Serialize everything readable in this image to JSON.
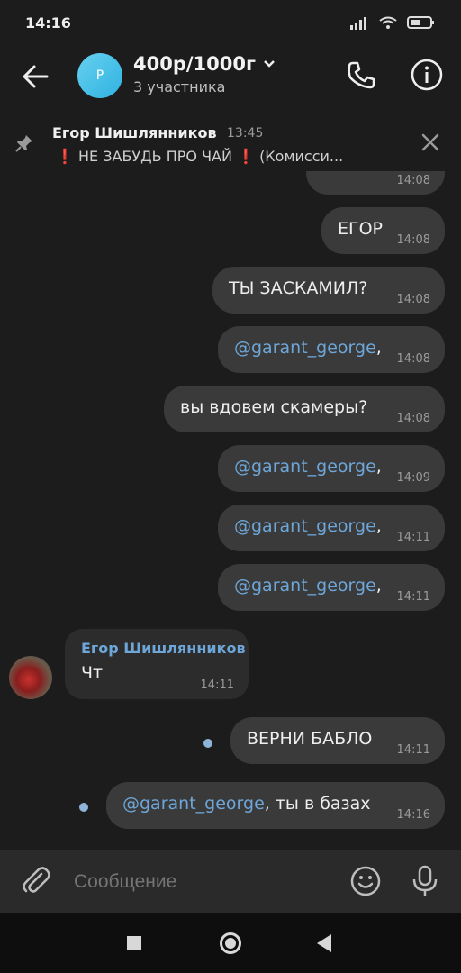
{
  "status": {
    "time": "14:16"
  },
  "header": {
    "avatar_letter": "P",
    "title": "400р/1000г",
    "subtitle": "3 участника"
  },
  "pinned": {
    "author": "Егор Шишлянников",
    "time": "13:45",
    "text": "❗ НЕ ЗАБУДЬ ПРО ЧАЙ ❗  (Комисси..."
  },
  "messages": [
    {
      "text": "",
      "time": "14:08"
    },
    {
      "text": "ЕГОР",
      "time": "14:08"
    },
    {
      "text": "ТЫ ЗАСКАМИЛ?",
      "time": "14:08"
    },
    {
      "mention": "@garant_george",
      "suffix": ",",
      "time": "14:08"
    },
    {
      "text": "вы вдовем скамеры?",
      "time": "14:08"
    },
    {
      "mention": "@garant_george",
      "suffix": ",",
      "time": "14:09"
    },
    {
      "mention": "@garant_george",
      "suffix": ",",
      "time": "14:11"
    },
    {
      "mention": "@garant_george",
      "suffix": ",",
      "time": "14:11"
    },
    {
      "sender": "Егор Шишлянников",
      "text": "Чт",
      "time": "14:11"
    },
    {
      "text": "ВЕРНИ БАБЛО",
      "time": "14:11"
    },
    {
      "mention": "@garant_george",
      "suffix": ",  ты в базах",
      "time": "14:16"
    }
  ],
  "input": {
    "placeholder": "Сообщение"
  }
}
